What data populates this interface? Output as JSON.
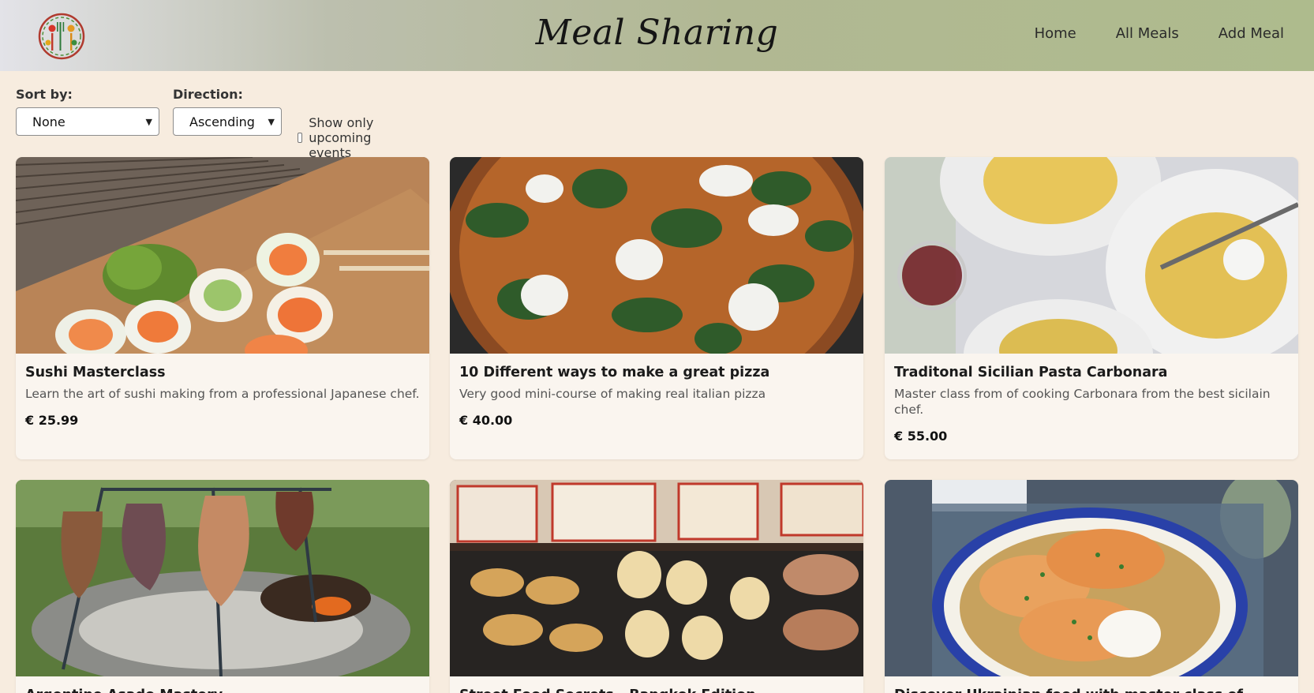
{
  "header": {
    "title": "Meal Sharing",
    "logo_icon": "utensils-logo-icon",
    "nav": [
      {
        "label": "Home"
      },
      {
        "label": "All Meals"
      },
      {
        "label": "Add Meal"
      }
    ]
  },
  "controls": {
    "sort_label": "Sort by:",
    "sort_value": "None",
    "direction_label": "Direction:",
    "direction_value": "Ascending",
    "upcoming_label": "Show only upcoming events",
    "upcoming_checked": false
  },
  "meals": [
    {
      "title": "Sushi Masterclass",
      "description": "Learn the art of sushi making from a professional Japanese chef.",
      "price": "€ 25.99",
      "image": "sushi-photo"
    },
    {
      "title": "10 Different ways to make a great pizza",
      "description": "Very good mini-course of making real italian pizza",
      "price": "€ 40.00",
      "image": "pizza-photo"
    },
    {
      "title": "Traditonal Sicilian Pasta Carbonara",
      "description": "Master class from of cooking Carbonara from the best sicilain chef.",
      "price": "€ 55.00",
      "image": "pasta-photo"
    },
    {
      "title": "Argentine Asado Mastery",
      "description": "",
      "price": "",
      "image": "asado-photo"
    },
    {
      "title": "Street Food Secrets - Bangkok Edition",
      "description": "",
      "price": "",
      "image": "street-food-photo"
    },
    {
      "title": "Discover Ukrainian food with master class of making",
      "description": "",
      "price": "",
      "image": "cabbage-rolls-photo"
    }
  ]
}
